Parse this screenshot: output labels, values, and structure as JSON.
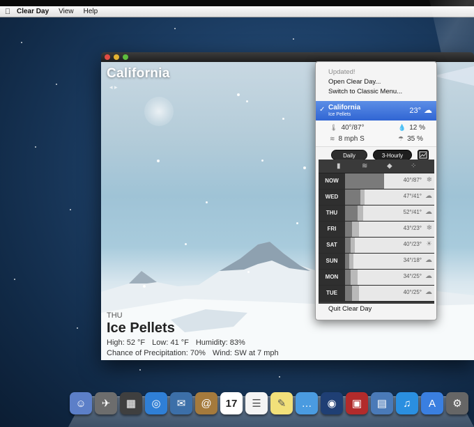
{
  "menubar": {
    "app": "Clear Day",
    "items": [
      "View",
      "Help"
    ]
  },
  "window": {
    "location": "California",
    "day": "THU",
    "condition": "Ice Pellets",
    "high": "High: 52 °F",
    "low": "Low: 41 °F",
    "humidity": "Humidity: 83%",
    "precip": "Chance of Precipitation: 70%",
    "wind": "Wind: SW at 7 mph"
  },
  "menu": {
    "updated": "Updated!",
    "open": "Open Clear Day...",
    "switch": "Switch to Classic Menu...",
    "selected_location": "California",
    "selected_sub": "Ice Pellets",
    "selected_temp": "23°",
    "temp_range": "40°/87°",
    "humidity": "12 %",
    "wind": "8 mph S",
    "precip": "35 %",
    "tabs": {
      "daily": "Daily",
      "hourly": "3-Hourly"
    },
    "rows": [
      {
        "day": "NOW",
        "temp": "40°/87°",
        "icon": "snow-icon"
      },
      {
        "day": "WED",
        "temp": "47°/41°",
        "icon": "cloud-icon"
      },
      {
        "day": "THU",
        "temp": "52°/41°",
        "icon": "cloud-icon"
      },
      {
        "day": "FRI",
        "temp": "43°/23°",
        "icon": "snow-icon"
      },
      {
        "day": "SAT",
        "temp": "40°/23°",
        "icon": "sun-icon"
      },
      {
        "day": "SUN",
        "temp": "34°/18°",
        "icon": "cloud-icon"
      },
      {
        "day": "MON",
        "temp": "34°/25°",
        "icon": "cloud-icon"
      },
      {
        "day": "TUE",
        "temp": "40°/25°",
        "icon": "cloud-icon"
      }
    ],
    "quit": "Quit Clear Day"
  },
  "dock": {
    "items": [
      "finder-icon",
      "launchpad-icon",
      "mission-control-icon",
      "safari-icon",
      "mail-icon",
      "contacts-icon",
      "calendar-icon",
      "reminders-icon",
      "notes-icon",
      "messages-icon",
      "facetime-icon",
      "photo-booth-icon",
      "iphoto-icon",
      "itunes-icon",
      "app-store-icon",
      "preferences-icon"
    ],
    "calendar_date": "17"
  }
}
